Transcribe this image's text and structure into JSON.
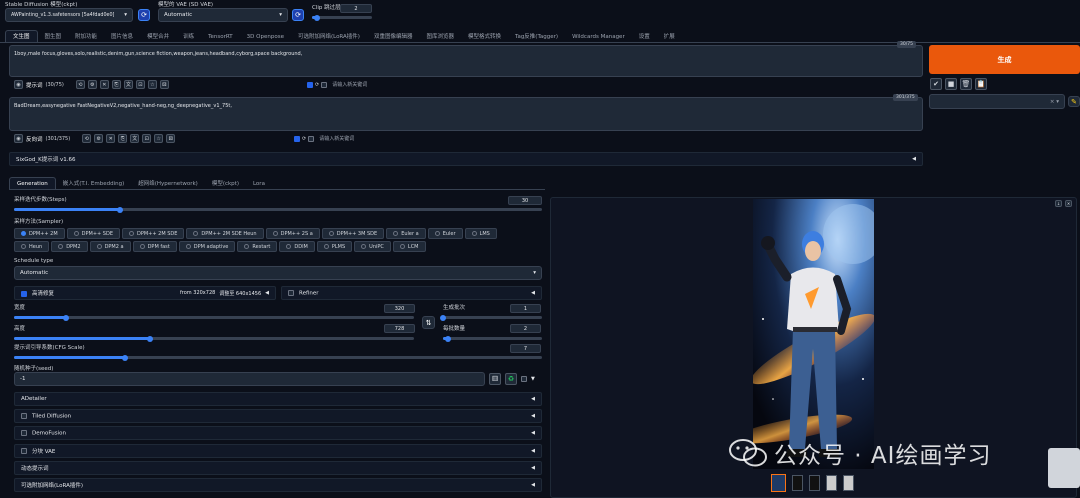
{
  "top": {
    "model_label": "Stable Diffusion 模型(ckpt)",
    "model_value": "AWPainting_v1.3.safetensors [5a4fdad0e0]",
    "vae_label": "模型的 VAE (SD VAE)",
    "vae_value": "Automatic",
    "clip_label": "Clip 跳过层",
    "clip_value": "2",
    "clip_fraction": 0.08,
    "refresh_icon": "refresh-icon"
  },
  "tabs": [
    "文生图",
    "图生图",
    "附加功能",
    "图片信息",
    "模型合并",
    "训练",
    "TensorRT",
    "3D Openpose",
    "可选附加网络(LoRA插件)",
    "双重图像编辑器",
    "图库浏览器",
    "模型格式转换",
    "Tag反推(Tagger)",
    "Wildcards Manager",
    "设置",
    "扩展"
  ],
  "prompt": {
    "text": "1boy,male focus,gloves,solo,realistic,denim,gun,science fiction,weapon,jeans,headband,cyborg,space background,",
    "counter": "30/75",
    "toolbar_label": "提示词",
    "toolbar_count": "(30/75)",
    "hint": "请输入新关键词"
  },
  "negative": {
    "text": "BadDream,easynegative FastNegativeV2,negative_hand-neg,ng_deepnegative_v1_75t,",
    "counter": "301/375",
    "toolbar_label": "反向词",
    "toolbar_count": "(301/375)",
    "hint": "请输入新关键词"
  },
  "generate": {
    "label": "生成"
  },
  "styles": {
    "tool_icons": [
      "check-icon",
      "square-icon",
      "trash-icon",
      "clipboard-icon"
    ]
  },
  "sixgod": {
    "label": "SixGod_K提示词 v1.66"
  },
  "subtabs": [
    "Generation",
    "嵌入式(T.I. Embedding)",
    "超网络(Hypernetwork)",
    "模型(ckpt)",
    "Lora"
  ],
  "steps": {
    "label": "采样迭代步数(Steps)",
    "value": "30",
    "fraction": 0.2
  },
  "sampler": {
    "label": "采样方法(Sampler)",
    "options": [
      "DPM++ 2M",
      "DPM++ SDE",
      "DPM++ 2M SDE",
      "DPM++ 2M SDE Heun",
      "DPM++ 2S a",
      "DPM++ 3M SDE",
      "Euler a",
      "Euler",
      "LMS",
      "Heun",
      "DPM2",
      "DPM2 a",
      "DPM fast",
      "DPM adaptive",
      "Restart",
      "DDIM",
      "PLMS",
      "UniPC",
      "LCM"
    ],
    "selected": "DPM++ 2M"
  },
  "schedule": {
    "label": "Schedule type",
    "value": "Automatic"
  },
  "hires": {
    "label": "高清修复",
    "from": "from 320x728",
    "to": "调整至 640x1456",
    "checked": true
  },
  "refiner": {
    "label": "Refiner"
  },
  "width": {
    "label": "宽度",
    "value": "320",
    "fraction": 0.13
  },
  "height": {
    "label": "高度",
    "value": "728",
    "fraction": 0.34
  },
  "batch_count": {
    "label": "生成批次",
    "value": "1",
    "fraction": 0.0
  },
  "batch_size": {
    "label": "每批数量",
    "value": "2",
    "fraction": 0.05
  },
  "cfg": {
    "label": "提示词引导系数(CFG Scale)",
    "value": "7",
    "fraction": 0.21
  },
  "seed": {
    "label": "随机种子(seed)",
    "value": "-1"
  },
  "accordions": [
    {
      "label": "ADetailer",
      "checkbox": false
    },
    {
      "label": "Tiled Diffusion",
      "checkbox": true
    },
    {
      "label": "DemoFusion",
      "checkbox": true
    },
    {
      "label": "分块 VAE",
      "checkbox": true
    },
    {
      "label": "动态提示词",
      "checkbox": false
    },
    {
      "label": "可选附加网络(LoRA插件)",
      "checkbox": false
    }
  ],
  "watermark": {
    "text": "公众号 · AI绘画学习"
  },
  "colors": {
    "accent": "#3b82f6",
    "generate": "#ea580c",
    "bg": "#0b0f19"
  }
}
